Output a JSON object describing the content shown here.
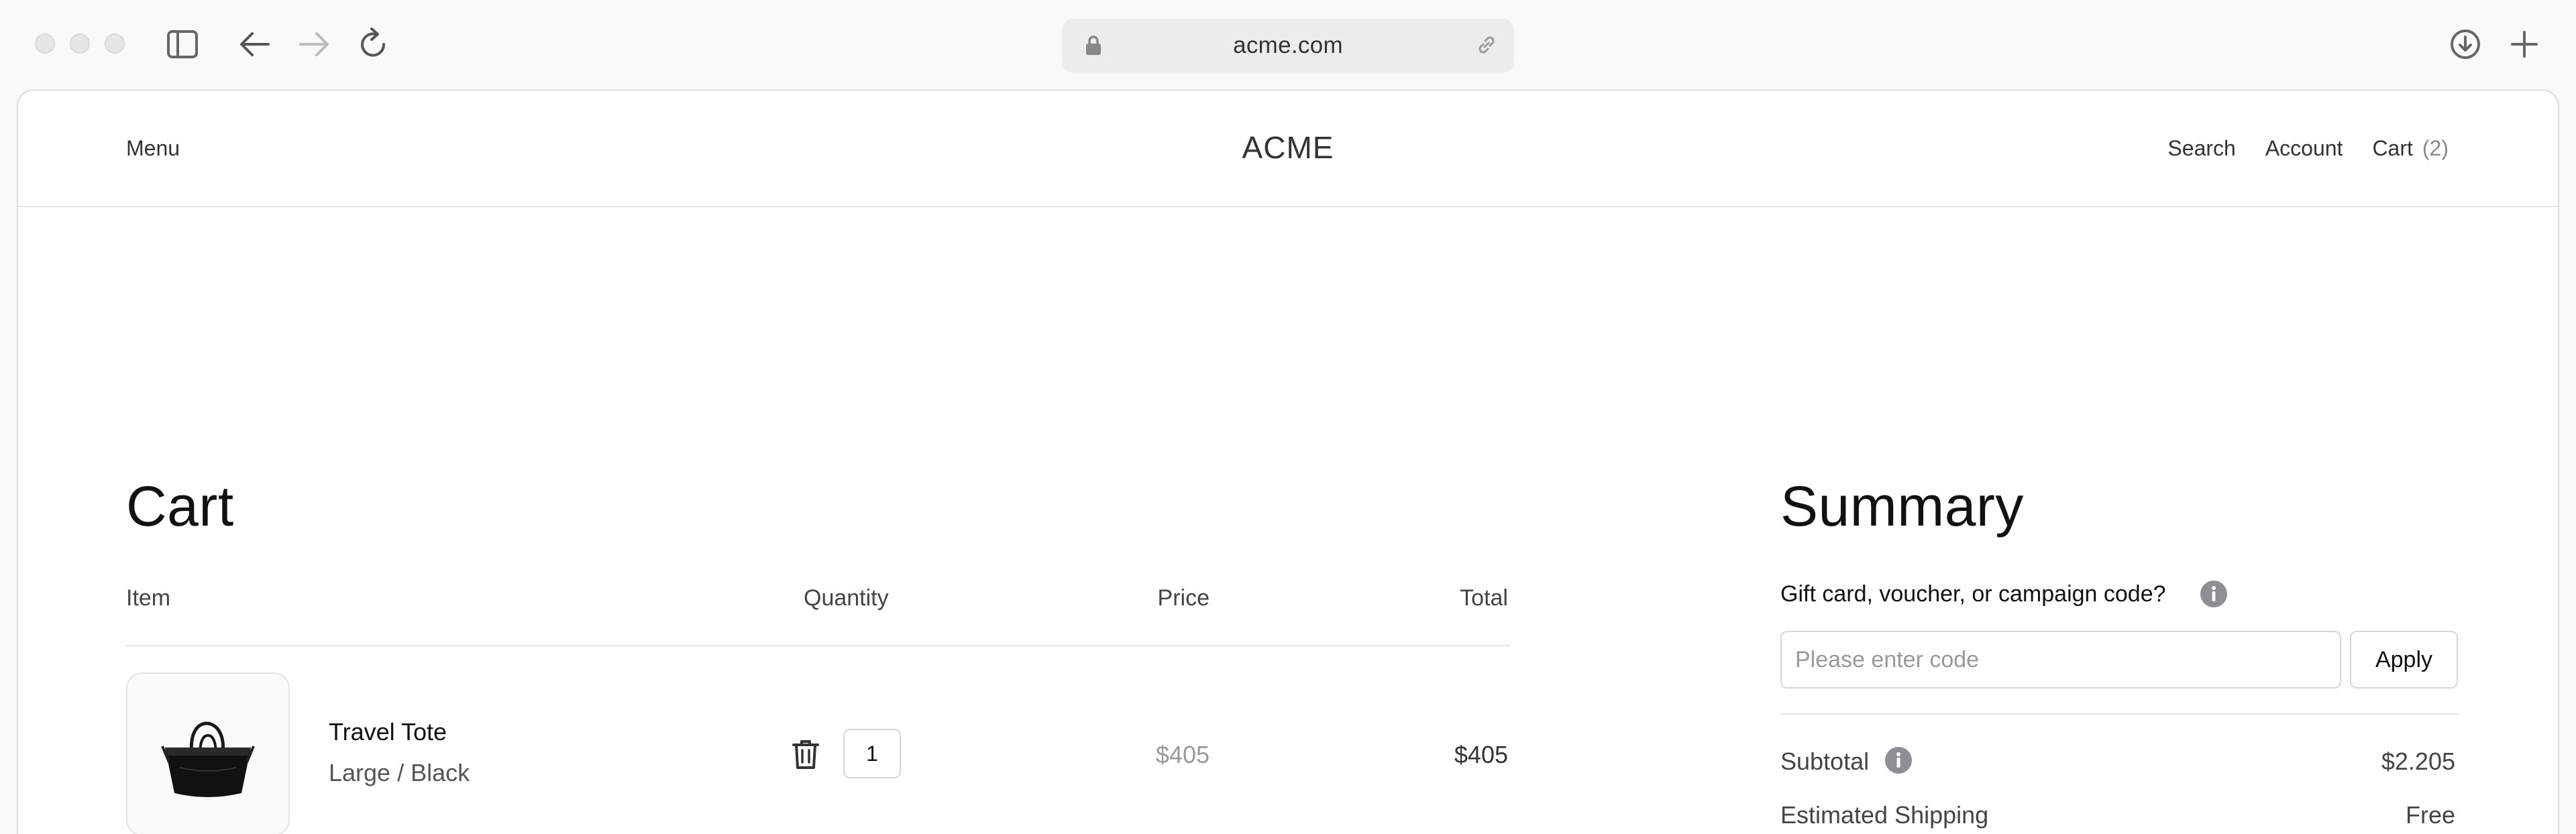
{
  "browser": {
    "url": "acme.com",
    "icons": [
      "sidebar-icon",
      "back-arrow-icon",
      "forward-arrow-icon",
      "reload-icon",
      "lock-icon",
      "link-icon",
      "download-icon",
      "new-tab-plus-icon"
    ]
  },
  "header": {
    "menu_label": "Menu",
    "brand": "ACME",
    "search_label": "Search",
    "account_label": "Account",
    "cart_label": "Cart",
    "cart_count": "(2)"
  },
  "cart": {
    "title": "Cart",
    "columns": {
      "item": "Item",
      "quantity": "Quantity",
      "price": "Price",
      "total": "Total"
    },
    "items": [
      {
        "name": "Travel Tote",
        "variant": "Large / Black",
        "quantity": "1",
        "price": "$405",
        "total": "$405",
        "icons": [
          "trash-icon"
        ]
      }
    ]
  },
  "summary": {
    "title": "Summary",
    "gift_label": "Gift card, voucher, or campaign code?",
    "code_placeholder": "Please enter code",
    "code_value": "",
    "apply_label": "Apply",
    "subtotal_label": "Subtotal",
    "subtotal_value": "$2.205",
    "shipping_label": "Estimated Shipping",
    "shipping_value": "Free"
  },
  "colors": {
    "page_bg": "#ffffff",
    "chrome_bg": "#f9f9f9",
    "border": "#e5e5e5",
    "muted_text": "#999999",
    "info_icon": "#8e8e93"
  }
}
